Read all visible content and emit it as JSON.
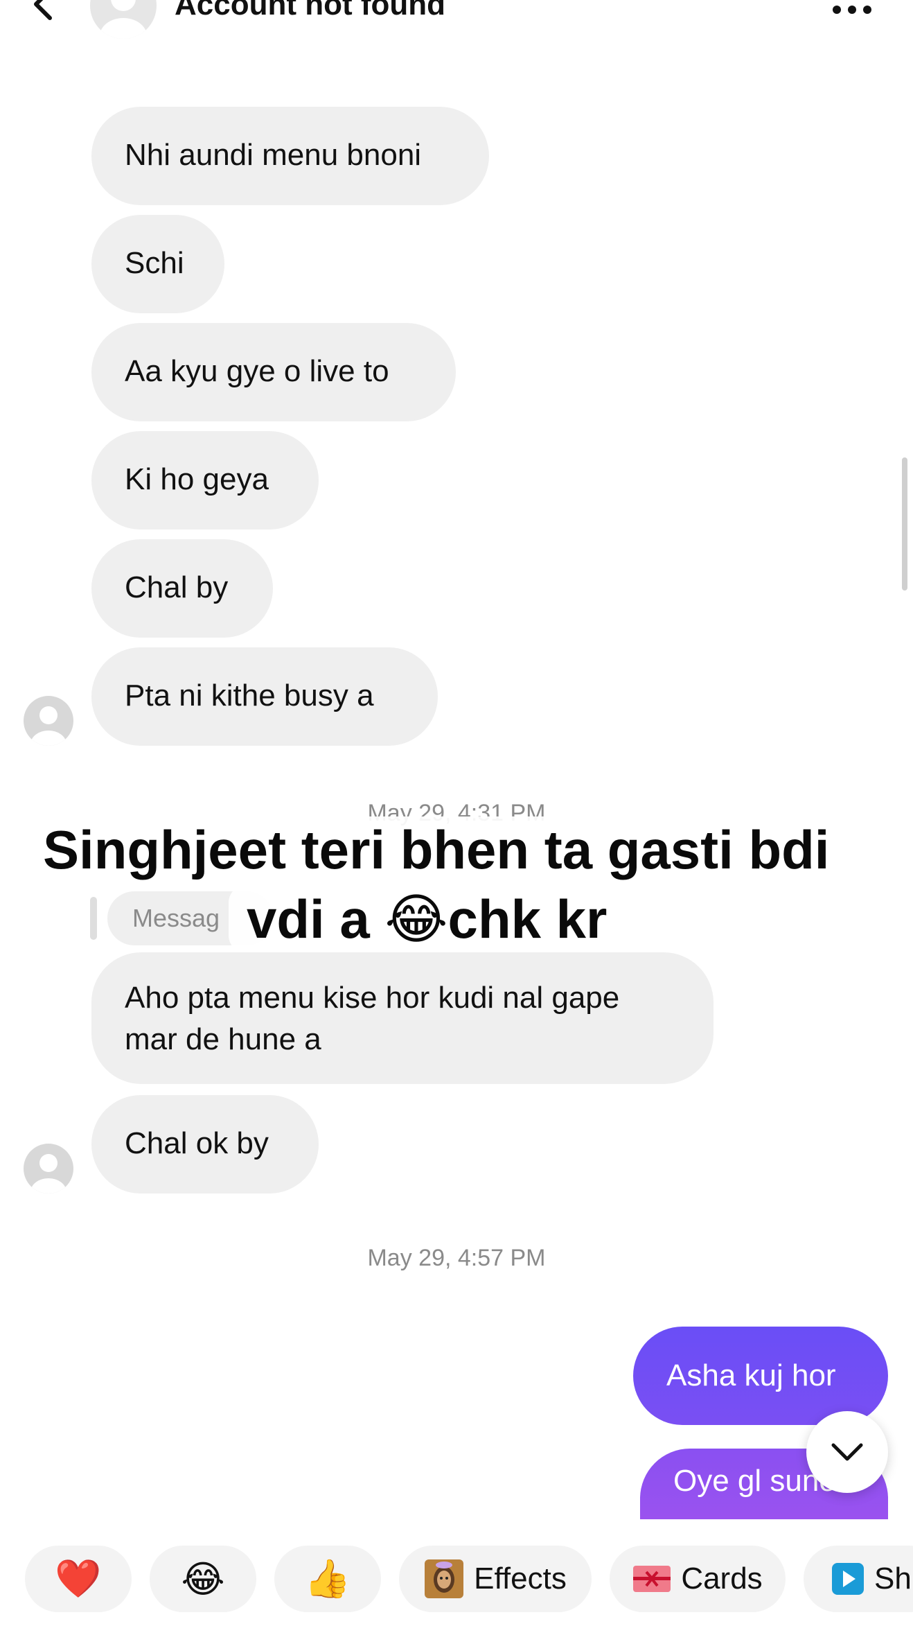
{
  "header": {
    "title": "Account not found"
  },
  "messages_in": [
    {
      "text": "Nhi aundi menu bnoni"
    },
    {
      "text": "Schi"
    },
    {
      "text": "Aa kyu gye o live to"
    },
    {
      "text": "Ki ho geya"
    },
    {
      "text": "Chal by"
    },
    {
      "text": "Pta ni kithe busy a"
    }
  ],
  "partial_timestamp": "May 29, 4:31 PM",
  "reply_preview": "Messag",
  "caption": {
    "line1": "Singhjeet teri bhen ta gasti bdi",
    "line2": "vdi a 😂chk kr"
  },
  "messages_in_2": [
    {
      "text": "Aho pta menu kise hor kudi nal gape mar de hune a"
    },
    {
      "text": "Chal ok by"
    }
  ],
  "timestamp": "May 29, 4:57 PM",
  "messages_out": [
    {
      "text": "Asha kuj hor"
    },
    {
      "text": "Oye gl suno"
    }
  ],
  "quick_reactions": [
    {
      "emoji": "❤️",
      "name": "heart"
    },
    {
      "emoji": "😂",
      "name": "laugh"
    },
    {
      "emoji": "👍",
      "name": "thumbs-up"
    }
  ],
  "chips": [
    {
      "label": "Effects"
    },
    {
      "label": "Cards"
    },
    {
      "label": "Sh"
    }
  ],
  "colors": {
    "outgoing_top": "#6b4df5",
    "outgoing_bottom": "#8a4ff0",
    "incoming": "#efefef"
  }
}
